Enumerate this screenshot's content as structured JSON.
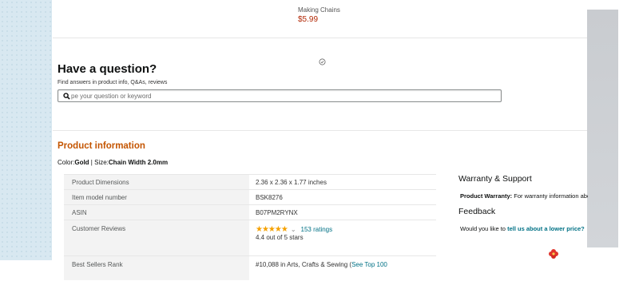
{
  "previous_item": {
    "title": "Making Chains",
    "price": "$5.99"
  },
  "qa": {
    "title": "Have a question?",
    "subtitle": "Find answers in product info, Q&As, reviews",
    "search_placeholder": "pe your question or keyword"
  },
  "product_information": {
    "title": "Product information",
    "color_label": "Color:",
    "color_value": "Gold",
    "separator": "|",
    "size_label": "Size:",
    "size_value": "Chain Width 2.0mm",
    "rows": [
      {
        "label": "Product Dimensions",
        "value": "2.36 x 2.36 x 1.77 inches"
      },
      {
        "label": "Item model number",
        "value": "BSK8276"
      },
      {
        "label": "ASIN",
        "value": "B07PM2RYNX"
      }
    ],
    "reviews": {
      "label": "Customer Reviews",
      "stars": "★★★★★",
      "rating_value": 4.4,
      "ratings_count": "153 ratings",
      "rating_text": "4.4 out of 5 stars"
    },
    "best_sellers": {
      "label": "Best Sellers Rank",
      "rank_text": "#10,088 in Arts, Crafts & Sewing (",
      "link_text": "See Top 100"
    }
  },
  "warranty": {
    "title": "Warranty & Support",
    "label": "Product Warranty:",
    "text": "For warranty information about this product, please click here"
  },
  "feedback": {
    "title": "Feedback",
    "prefix": "Would you like to",
    "link": "tell us about a lower price?"
  },
  "icons": {
    "spinner": "loading-spinner-icon",
    "search": "search-icon",
    "flower": "flower-icon"
  },
  "colors": {
    "section_title": "#c45500",
    "link": "#007185",
    "price": "#b12704",
    "star": "#f5a100"
  }
}
